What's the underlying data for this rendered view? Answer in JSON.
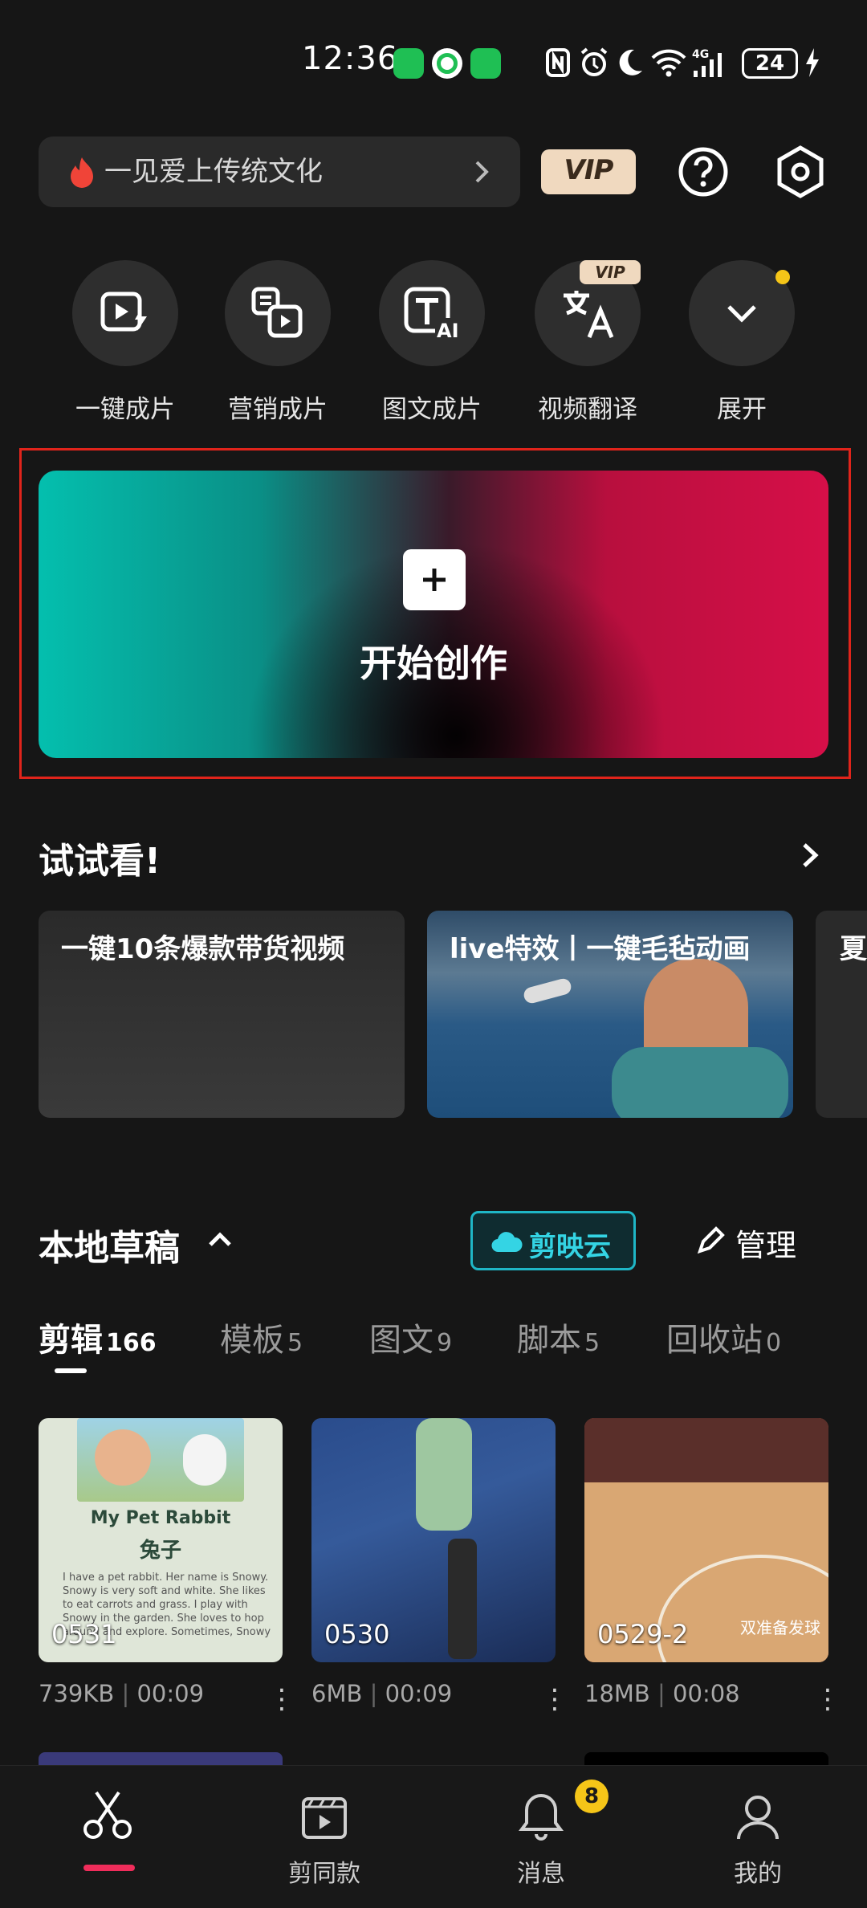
{
  "status_bar": {
    "time": "12:36",
    "battery": "24"
  },
  "header": {
    "search_text": "一见爱上传统文化",
    "vip_label": "VIP"
  },
  "quick_actions": [
    {
      "label": "一键成片",
      "icon": "video-bolt-icon"
    },
    {
      "label": "营销成片",
      "icon": "marketing-video-icon"
    },
    {
      "label": "图文成片",
      "icon": "text-ai-icon"
    },
    {
      "label": "视频翻译",
      "icon": "translate-icon",
      "badge": "VIP"
    },
    {
      "label": "展开",
      "icon": "chevron-down-icon"
    }
  ],
  "hero": {
    "title": "开始创作"
  },
  "try_section": {
    "title": "试试看!",
    "cards": [
      {
        "label": "一键10条爆款带货视频"
      },
      {
        "label": "live特效丨一键毛毡动画"
      },
      {
        "label": "夏"
      }
    ]
  },
  "drafts": {
    "title": "本地草稿",
    "cloud_label": "剪映云",
    "manage_label": "管理",
    "tabs": [
      {
        "label": "剪辑",
        "count": "166"
      },
      {
        "label": "模板",
        "count": "5"
      },
      {
        "label": "图文",
        "count": "9"
      },
      {
        "label": "脚本",
        "count": "5"
      },
      {
        "label": "回收站",
        "count": "0"
      }
    ],
    "items": [
      {
        "name": "0531",
        "size": "739KB",
        "duration": "00:09",
        "thumb_title": "My Pet Rabbit",
        "thumb_subtitle": "兔子",
        "thumb_body": "I have a pet rabbit. Her name is Snowy. Snowy is very soft and white. She likes to eat carrots and grass. I play with Snowy in the garden. She loves to hop around and explore. Sometimes, Snowy"
      },
      {
        "name": "0530",
        "size": "6MB",
        "duration": "00:09"
      },
      {
        "name": "0529-2",
        "size": "18MB",
        "duration": "00:08",
        "caption": "双准备发球"
      }
    ]
  },
  "bottom_nav": [
    {
      "label": "",
      "icon": "scissors-icon",
      "active": true
    },
    {
      "label": "剪同款",
      "icon": "template-video-icon"
    },
    {
      "label": "消息",
      "icon": "bell-icon",
      "badge": "8"
    },
    {
      "label": "我的",
      "icon": "profile-icon"
    }
  ],
  "colors": {
    "accent": "#f02d5b",
    "cloud": "#1fb6c6",
    "vip": "#f0d9bf",
    "badge": "#f5c518",
    "highlight_frame": "#e0241b"
  }
}
